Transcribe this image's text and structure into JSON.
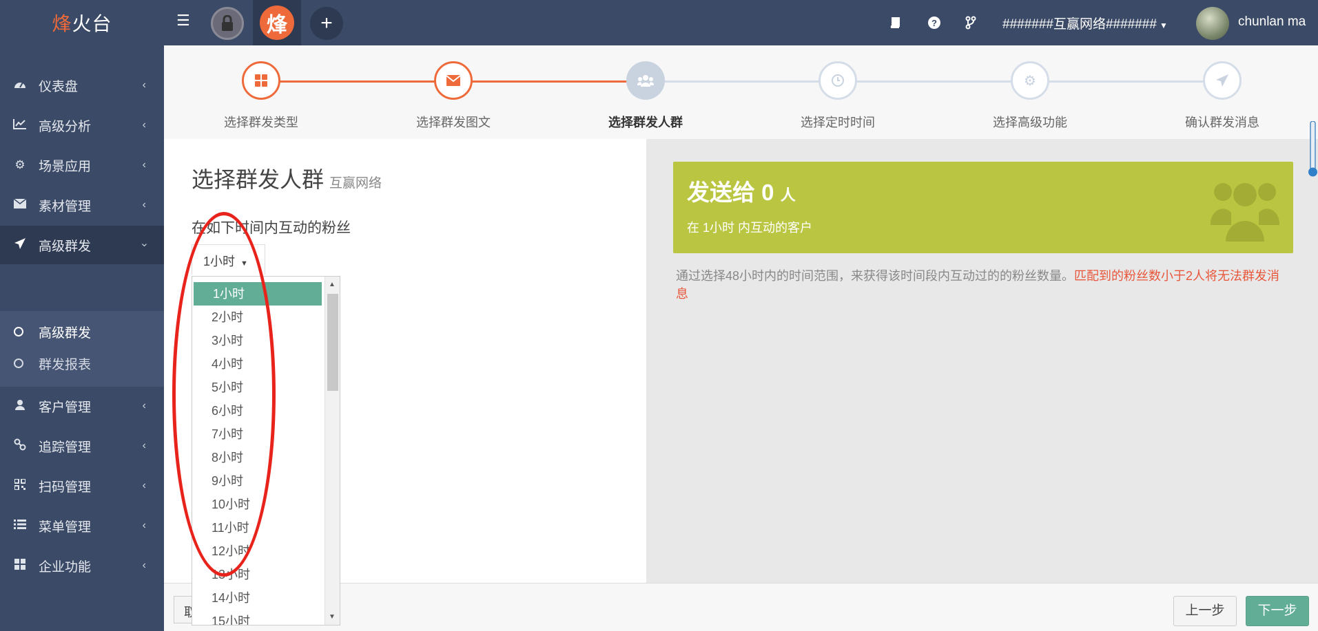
{
  "topbar": {
    "logo_accent": "烽",
    "logo_rest": "火台",
    "brand_glyph": "烽",
    "org_name": "#######互赢网络#######",
    "username": "chunlan ma"
  },
  "sidebar": {
    "items": [
      {
        "label": "仪表盘",
        "icon": "dashboard-icon"
      },
      {
        "label": "高级分析",
        "icon": "line-chart-icon"
      },
      {
        "label": "场景应用",
        "icon": "gear-icon"
      },
      {
        "label": "素材管理",
        "icon": "envelope-icon"
      },
      {
        "label": "高级群发",
        "icon": "paper-plane-icon"
      },
      {
        "label": "客户管理",
        "icon": "user-icon"
      },
      {
        "label": "追踪管理",
        "icon": "link-icon"
      },
      {
        "label": "扫码管理",
        "icon": "qrcode-icon"
      },
      {
        "label": "菜单管理",
        "icon": "list-icon"
      },
      {
        "label": "企业功能",
        "icon": "grid-icon"
      }
    ],
    "sub_items": [
      {
        "label": "高级群发"
      },
      {
        "label": "群发报表"
      }
    ]
  },
  "stepper": {
    "steps": [
      {
        "label": "选择群发类型",
        "state": "done",
        "icon": "grid-icon"
      },
      {
        "label": "选择群发图文",
        "state": "done",
        "icon": "envelope-icon"
      },
      {
        "label": "选择群发人群",
        "state": "current",
        "icon": "users-icon"
      },
      {
        "label": "选择定时时间",
        "state": "todo",
        "icon": "clock-icon"
      },
      {
        "label": "选择高级功能",
        "state": "todo",
        "icon": "gear-icon"
      },
      {
        "label": "确认群发消息",
        "state": "todo",
        "icon": "paper-plane-icon"
      }
    ]
  },
  "main": {
    "title": "选择群发人群",
    "subtitle": "互赢网络",
    "question": "在如下时间内互动的粉丝",
    "selected_value": "1小时",
    "options": [
      "1小时",
      "2小时",
      "3小时",
      "4小时",
      "5小时",
      "6小时",
      "7小时",
      "8小时",
      "9小时",
      "10小时",
      "11小时",
      "12小时",
      "13小时",
      "14小时",
      "15小时"
    ]
  },
  "summary": {
    "send_prefix": "发送给",
    "count": "0",
    "unit": "人",
    "subtitle": "在 1小时 内互动的客户",
    "hint": "通过选择48小时内的时间范围，来获得该时间段内互动过的的粉丝数量。",
    "warning": "匹配到的粉丝数小于2人将无法群发消息"
  },
  "footer": {
    "cancel_label": "取",
    "prev_label": "上一步",
    "next_label": "下一步"
  },
  "colors": {
    "accent": "#ee6a3a",
    "sidebar": "#3b4a66",
    "card": "#bac641",
    "primary_button": "#62ad96",
    "warning": "#e8573b"
  }
}
